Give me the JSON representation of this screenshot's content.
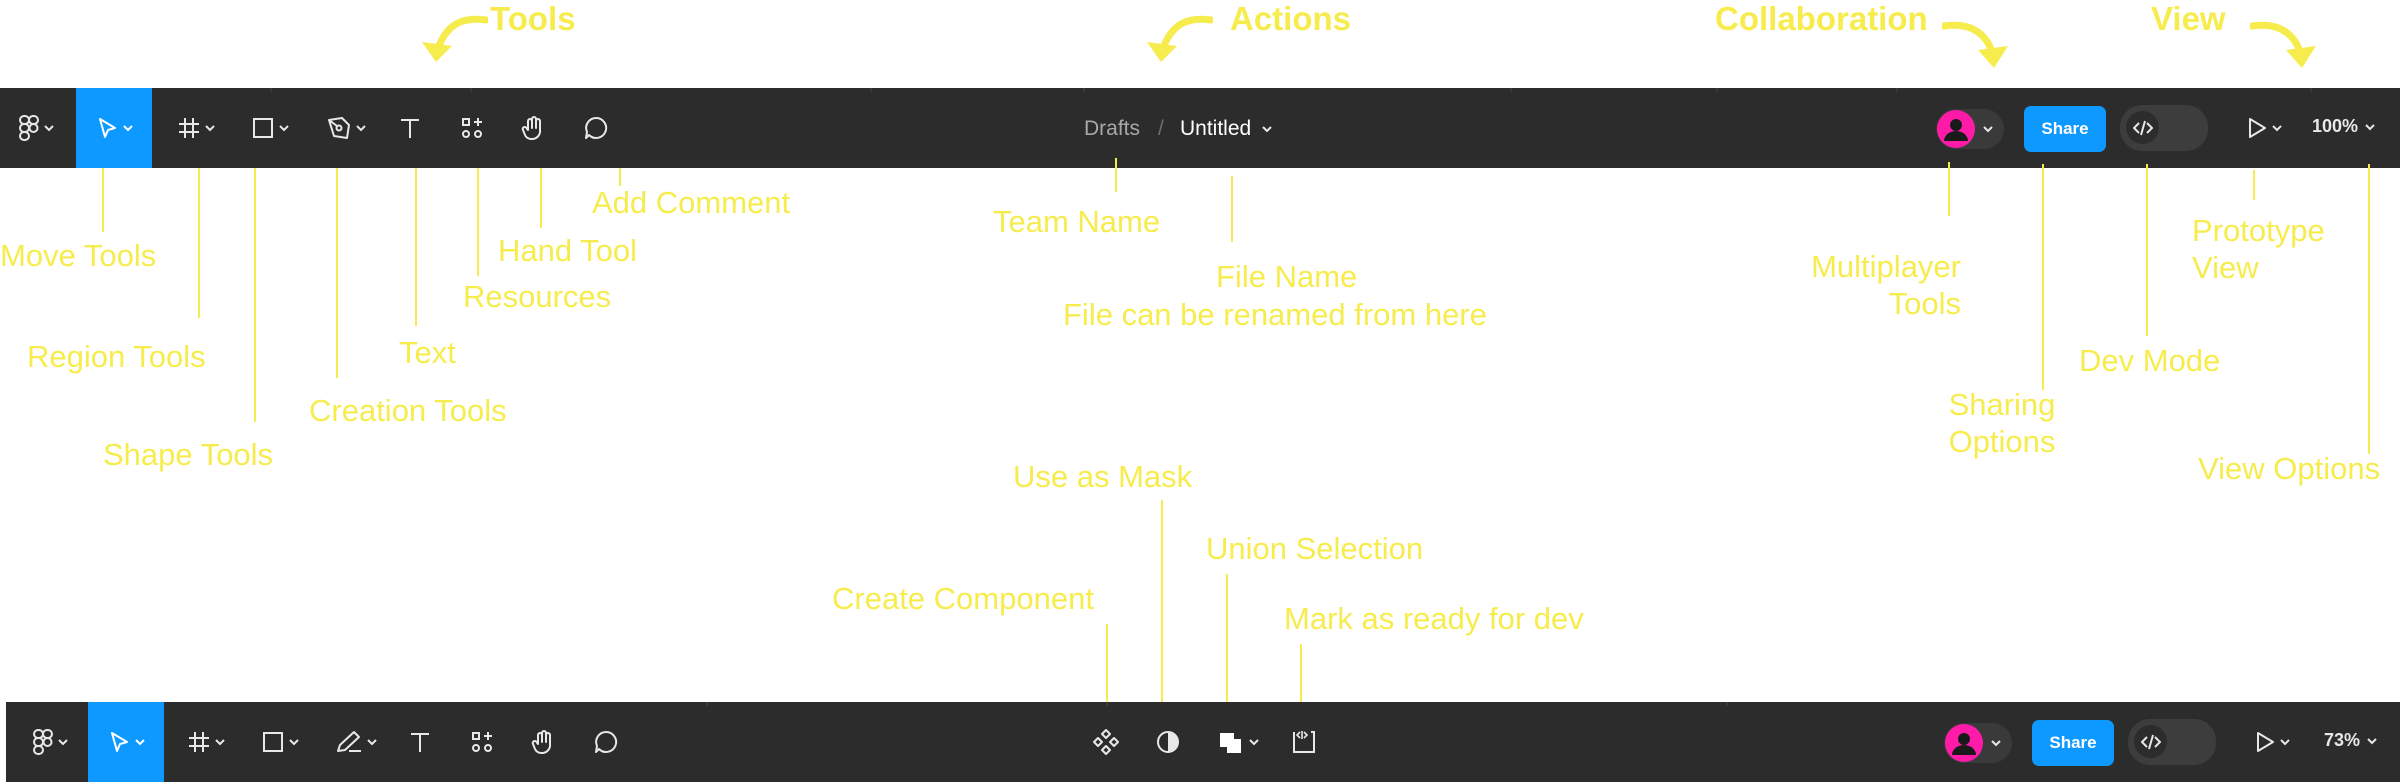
{
  "colors": {
    "toolbar_bg": "#2c2c2c",
    "accent": "#0d99ff",
    "annotation": "#f7ec4d",
    "avatar": "#ff1aa8"
  },
  "headers": {
    "tools": "Tools",
    "actions": "Actions",
    "collaboration": "Collaboration",
    "view": "View"
  },
  "breadcrumb": {
    "team": "Drafts",
    "separator": "/",
    "file": "Untitled"
  },
  "toolbar": {
    "share_label": "Share",
    "zoom_top": "100%",
    "zoom_bottom": "73%"
  },
  "icons": [
    "main-menu-icon",
    "move-tool-icon",
    "frame-tool-icon",
    "rectangle-tool-icon",
    "pen-tool-icon",
    "text-tool-icon",
    "resources-icon",
    "hand-tool-icon",
    "comment-icon",
    "component-icon",
    "mask-icon",
    "union-icon",
    "ready-for-dev-icon",
    "code-icon",
    "play-icon",
    "chevron-down-icon"
  ],
  "labels": {
    "move_tools": "Move Tools",
    "region_tools": "Region Tools",
    "shape_tools": "Shape Tools",
    "creation_tools": "Creation Tools",
    "text": "Text",
    "resources": "Resources",
    "hand_tool": "Hand Tool",
    "add_comment": "Add Comment",
    "team_name": "Team Name",
    "file_name": "File Name",
    "file_rename": "File can be renamed from here",
    "multiplayer_1": "Multiplayer",
    "multiplayer_2": "Tools",
    "sharing_1": "Sharing",
    "sharing_2": "Options",
    "dev_mode": "Dev Mode",
    "prototype_1": "Prototype",
    "prototype_2": "View",
    "view_options": "View Options",
    "use_as_mask": "Use as Mask",
    "union_selection": "Union Selection",
    "create_component": "Create Component",
    "mark_ready": "Mark as ready for dev"
  }
}
